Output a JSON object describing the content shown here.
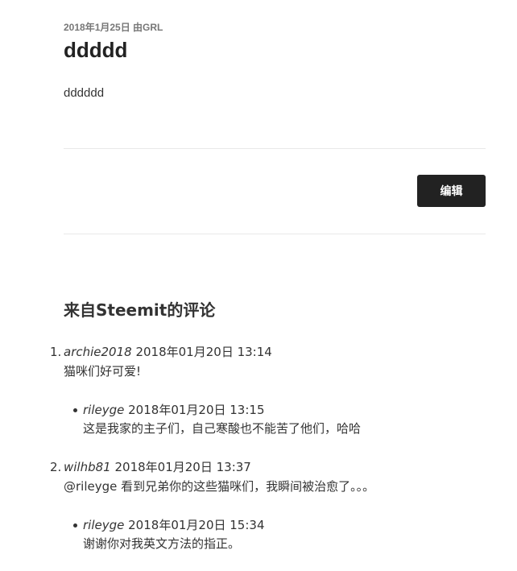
{
  "post": {
    "meta": "2018年1月25日 由GRL",
    "title": "ddddd",
    "body": "dddddd"
  },
  "actions": {
    "edit_label": "编辑"
  },
  "comments_section": {
    "heading": "来自Steemit的评论",
    "items": [
      {
        "number": "1.",
        "author": "archie2018",
        "date": "2018年01月20日 13:14",
        "text": "猫咪们好可爱!",
        "replies": [
          {
            "author": "rileyge",
            "date": "2018年01月20日 13:15",
            "text": "这是我家的主子们，自己寒酸也不能苦了他们，哈哈"
          }
        ]
      },
      {
        "number": "2.",
        "author": "wilhb81",
        "date": "2018年01月20日 13:37",
        "text": "@rileyge 看到兄弟你的这些猫咪们，我瞬间被治愈了。。。",
        "replies": [
          {
            "author": "rileyge",
            "date": "2018年01月20日 15:34",
            "text": "谢谢你对我英文方法的指正。"
          }
        ]
      }
    ]
  }
}
